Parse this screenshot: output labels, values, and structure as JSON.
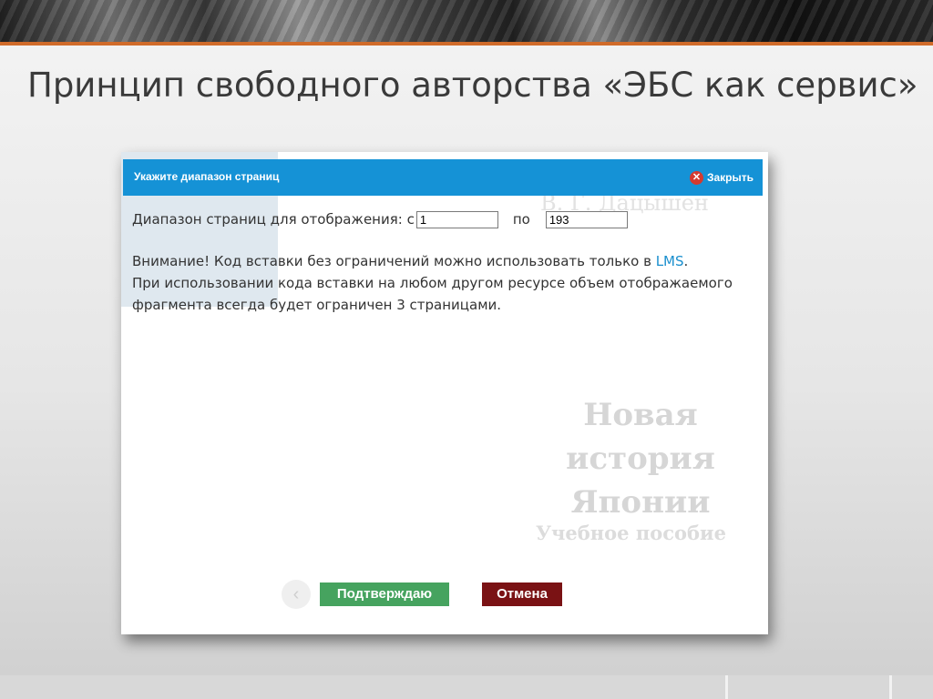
{
  "slide": {
    "title": "Принцип свободного авторства «ЭБС как сервис»"
  },
  "background_page": {
    "author": "В. Г. Дацышен",
    "book_title_line1": "Новая история",
    "book_title_line2": "Японии",
    "subtitle": "Учебное пособие"
  },
  "dialog": {
    "title": "Укажите диапазон страниц",
    "close_label": "Закрыть",
    "close_icon": "close-circle-icon",
    "range_label": "Диапазон страниц для отображения: с",
    "range_from": "1",
    "range_to_label": "по",
    "range_to": "193",
    "notice_text": "Внимание! Код вставки без ограничений можно использовать только в",
    "notice_link": "LMS",
    "notice_end": ".",
    "notice_line2": "При использовании кода вставки на любом другом ресурсе объем отображаемого фрагмента всегда будет ограничен 3 страницами",
    "notice_line2_end": ".",
    "confirm_label": "Подтверждаю",
    "cancel_label": "Отмена"
  },
  "colors": {
    "header_bg": "#1592d6",
    "confirm_bg": "#46a35f",
    "cancel_bg": "#7a1214",
    "link": "#1a8fce",
    "accent_line": "#d06b2a"
  }
}
